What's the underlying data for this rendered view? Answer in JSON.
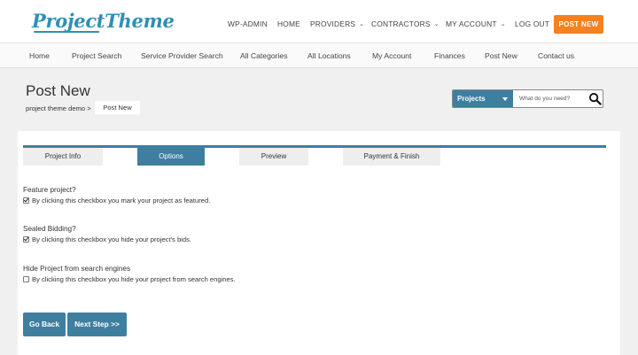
{
  "header": {
    "logo_text": "ProjectTheme",
    "nav": [
      {
        "label": "WP-ADMIN"
      },
      {
        "label": "HOME"
      },
      {
        "label": "PROVIDERS"
      },
      {
        "label": "CONTRACTORS"
      },
      {
        "label": "MY ACCOUNT"
      },
      {
        "label": "LOG OUT"
      }
    ],
    "post_new_label": "POST NEW"
  },
  "menu": {
    "items": [
      {
        "label": "Home"
      },
      {
        "label": "Project Search"
      },
      {
        "label": "Service Provider Search"
      },
      {
        "label": "All Categories"
      },
      {
        "label": "All Locations"
      },
      {
        "label": "My Account"
      },
      {
        "label": "Finances"
      },
      {
        "label": "Post New"
      },
      {
        "label": "Contact us"
      }
    ]
  },
  "page": {
    "title": "Post New",
    "breadcrumb": {
      "parent": "project theme demo >",
      "current": "Post New"
    }
  },
  "search": {
    "category": "Projects",
    "placeholder": "What do you need?"
  },
  "tabs": [
    {
      "label": "Project Info",
      "active": false
    },
    {
      "label": "Options",
      "active": true
    },
    {
      "label": "Preview",
      "active": false
    },
    {
      "label": "Payment & Finish",
      "active": false
    }
  ],
  "options": [
    {
      "title": "Feature project?",
      "description": "By clicking this checkbox you mark your project as featured.",
      "checked": true
    },
    {
      "title": "Sealed Bidding?",
      "description": "By clicking this checkbox you hide your project's bids.",
      "checked": true
    },
    {
      "title": "Hide Project from search engines",
      "description": "By clicking this checkbox you hide your project from search engines.",
      "checked": false
    }
  ],
  "buttons": {
    "back": "Go Back",
    "next": "Next Step >>"
  },
  "colors": {
    "brand": "#2f8fb5",
    "accent": "#3e7fa0",
    "post_new": "#f5821f"
  }
}
